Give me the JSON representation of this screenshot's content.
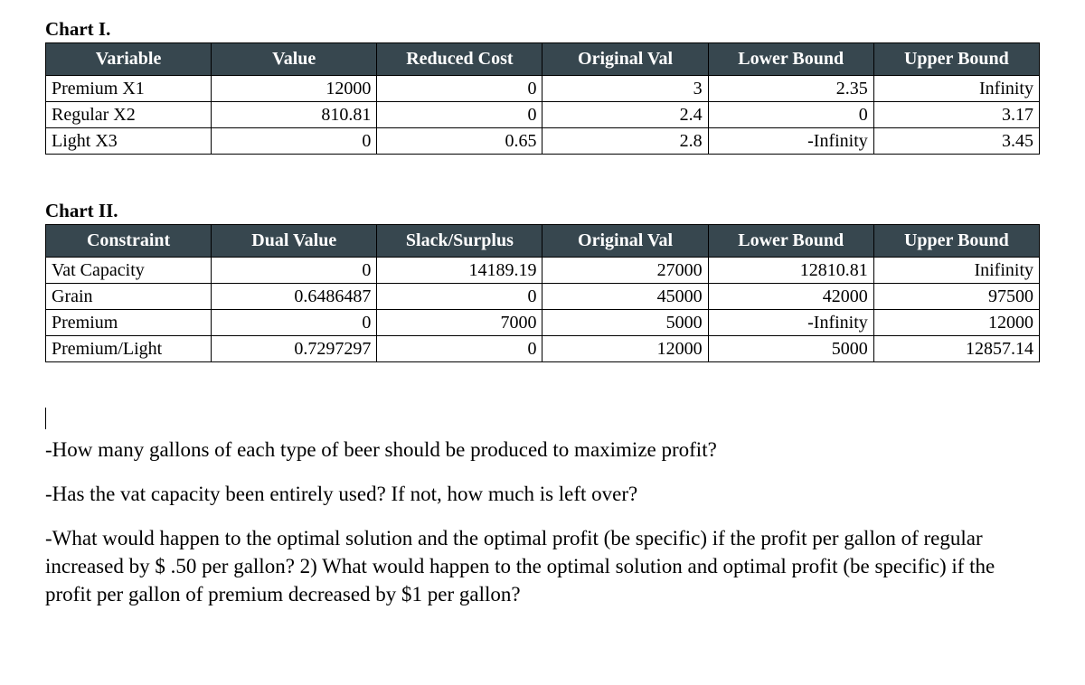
{
  "chart1": {
    "title": "Chart I.",
    "headers": [
      "Variable",
      "Value",
      "Reduced Cost",
      "Original Val",
      "Lower Bound",
      "Upper Bound"
    ],
    "rows": [
      {
        "label": "Premium X1",
        "value": "12000",
        "reduced_cost": "0",
        "original_val": "3",
        "lower_bound": "2.35",
        "upper_bound": "Infinity"
      },
      {
        "label": "Regular X2",
        "value": "810.81",
        "reduced_cost": "0",
        "original_val": "2.4",
        "lower_bound": "0",
        "upper_bound": "3.17"
      },
      {
        "label": "Light X3",
        "value": "0",
        "reduced_cost": "0.65",
        "original_val": "2.8",
        "lower_bound": "-Infinity",
        "upper_bound": "3.45"
      }
    ]
  },
  "chart2": {
    "title": "Chart II.",
    "headers": [
      "Constraint",
      "Dual Value",
      "Slack/Surplus",
      "Original Val",
      "Lower Bound",
      "Upper Bound"
    ],
    "rows": [
      {
        "label": "Vat Capacity",
        "dual_value": "0",
        "slack_surplus": "14189.19",
        "original_val": "27000",
        "lower_bound": "12810.81",
        "upper_bound": "Inifinity"
      },
      {
        "label": "Grain",
        "dual_value": "0.6486487",
        "slack_surplus": "0",
        "original_val": "45000",
        "lower_bound": "42000",
        "upper_bound": "97500"
      },
      {
        "label": "Premium",
        "dual_value": "0",
        "slack_surplus": "7000",
        "original_val": "5000",
        "lower_bound": "-Infinity",
        "upper_bound": "12000"
      },
      {
        "label": "Premium/Light",
        "dual_value": "0.7297297",
        "slack_surplus": "0",
        "original_val": "12000",
        "lower_bound": "5000",
        "upper_bound": "12857.14"
      }
    ]
  },
  "questions": {
    "q1": "-How many gallons of each type of beer should be produced to maximize profit?",
    "q2": "-Has the vat capacity been entirely used?  If not, how much is left over?",
    "q3": "-What would happen to the optimal solution and the optimal profit (be specific) if the profit per gallon of regular increased by $ .50 per gallon?  2) What would happen to the optimal solution and optimal profit (be specific) if the profit per gallon of premium decreased by $1 per gallon?"
  },
  "chart_data": [
    {
      "type": "table",
      "title": "Chart I.",
      "columns": [
        "Variable",
        "Value",
        "Reduced Cost",
        "Original Val",
        "Lower Bound",
        "Upper Bound"
      ],
      "rows": [
        [
          "Premium X1",
          12000,
          0,
          3,
          2.35,
          "Infinity"
        ],
        [
          "Regular X2",
          810.81,
          0,
          2.4,
          0,
          3.17
        ],
        [
          "Light X3",
          0,
          0.65,
          2.8,
          "-Infinity",
          3.45
        ]
      ]
    },
    {
      "type": "table",
      "title": "Chart II.",
      "columns": [
        "Constraint",
        "Dual Value",
        "Slack/Surplus",
        "Original Val",
        "Lower Bound",
        "Upper Bound"
      ],
      "rows": [
        [
          "Vat Capacity",
          0,
          14189.19,
          27000,
          12810.81,
          "Inifinity"
        ],
        [
          "Grain",
          0.6486487,
          0,
          45000,
          42000,
          97500
        ],
        [
          "Premium",
          0,
          7000,
          5000,
          "-Infinity",
          12000
        ],
        [
          "Premium/Light",
          0.7297297,
          0,
          12000,
          5000,
          12857.14
        ]
      ]
    }
  ]
}
